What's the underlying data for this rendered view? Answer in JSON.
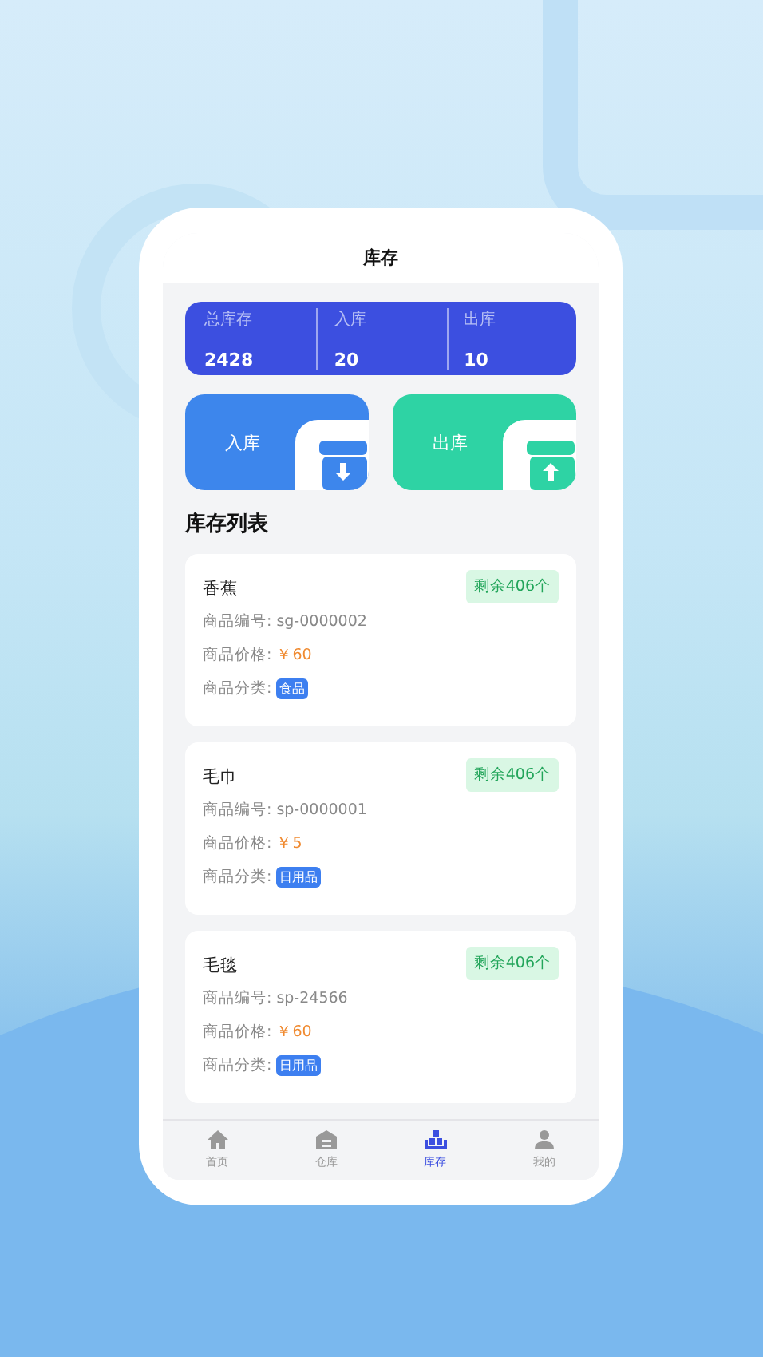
{
  "header": {
    "title": "库存"
  },
  "stats": [
    {
      "label": "总库存",
      "value": "2428"
    },
    {
      "label": "入库",
      "value": "20"
    },
    {
      "label": "出库",
      "value": "10"
    }
  ],
  "actions": [
    {
      "label": "入库",
      "kind": "in"
    },
    {
      "label": "出库",
      "kind": "out"
    }
  ],
  "list_title": "库存列表",
  "items": [
    {
      "name": "香蕉",
      "stock": "剩余406个",
      "code_label": "商品编号:",
      "code": "sg-0000002",
      "price_label": "商品价格:",
      "price": "￥60",
      "category_label": "商品分类:",
      "category": "食品"
    },
    {
      "name": "毛巾",
      "stock": "剩余406个",
      "code_label": "商品编号:",
      "code": "sp-0000001",
      "price_label": "商品价格:",
      "price": "￥5",
      "category_label": "商品分类:",
      "category": "日用品"
    },
    {
      "name": "毛毯",
      "stock": "剩余406个",
      "code_label": "商品编号:",
      "code": "sp-24566",
      "price_label": "商品价格:",
      "price": "￥60",
      "category_label": "商品分类:",
      "category": "日用品"
    }
  ],
  "tabbar": [
    {
      "label": "首页",
      "kind": "home",
      "selected": false
    },
    {
      "label": "仓库",
      "kind": "warehouse",
      "selected": false
    },
    {
      "label": "库存",
      "kind": "stock",
      "selected": true
    },
    {
      "label": "我的",
      "kind": "user",
      "selected": false
    }
  ]
}
